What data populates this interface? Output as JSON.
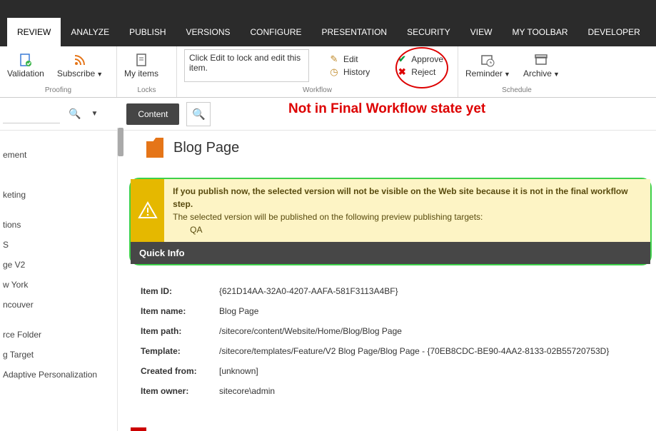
{
  "tabs": [
    "REVIEW",
    "ANALYZE",
    "PUBLISH",
    "VERSIONS",
    "CONFIGURE",
    "PRESENTATION",
    "SECURITY",
    "VIEW",
    "MY TOOLBAR",
    "DEVELOPER"
  ],
  "ribbon": {
    "groups": {
      "proofing": {
        "label": "Proofing",
        "validation": "Validation",
        "subscribe": "Subscribe"
      },
      "locks": {
        "label": "Locks",
        "myitems": "My items"
      },
      "workflow": {
        "label": "Workflow",
        "message": "Click Edit to lock and edit this item.",
        "edit": "Edit",
        "history": "History",
        "approve": "Approve",
        "reject": "Reject"
      },
      "schedule": {
        "label": "Schedule",
        "reminder": "Reminder",
        "archive": "Archive"
      }
    }
  },
  "content_pill": "Content",
  "annotation": "Not in Final Workflow state yet",
  "tree_items": [
    "",
    "ement",
    "",
    "",
    "keting",
    "",
    "tions",
    "S",
    "ge V2",
    "w York",
    "ncouver",
    "",
    "rce Folder",
    "g Target",
    "Adaptive Personalization"
  ],
  "page": {
    "title": "Blog Page"
  },
  "warning": {
    "line1": "If you publish now, the selected version will not be visible on the Web site because it is not in the final workflow step.",
    "line2": "The selected version will be published on the following preview publishing targets:",
    "target": "QA"
  },
  "quick_info_label": "Quick Info",
  "info": {
    "item_id_k": "Item ID:",
    "item_id_v": "{621D14AA-32A0-4207-AAFA-581F3113A4BF}",
    "item_name_k": "Item name:",
    "item_name_v": "Blog Page",
    "item_path_k": "Item path:",
    "item_path_v": "/sitecore/content/Website/Home/Blog/Blog Page",
    "template_k": "Template:",
    "template_v": "/sitecore/templates/Feature/V2 Blog Page/Blog Page - {70EB8CDC-BE90-4AA2-8133-02B55720753D}",
    "created_k": "Created from:",
    "created_v": "[unknown]",
    "owner_k": "Item owner:",
    "owner_v": "sitecore\\admin"
  }
}
